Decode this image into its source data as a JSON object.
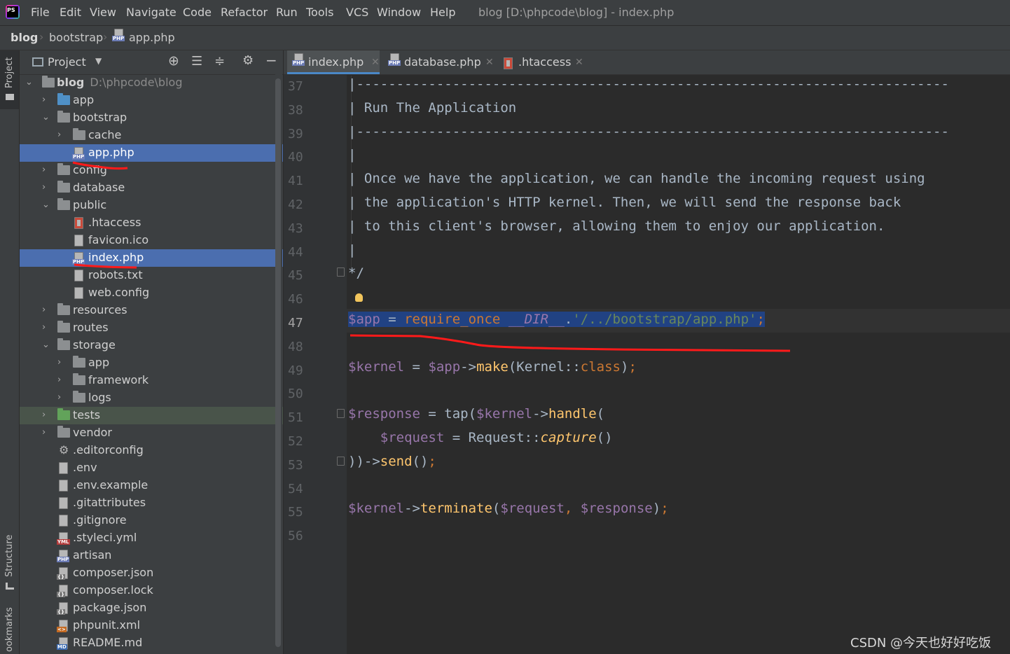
{
  "app": {
    "logo_text": "PS",
    "window_title": "blog [D:\\phpcode\\blog] - index.php",
    "menu": [
      "File",
      "Edit",
      "View",
      "Navigate",
      "Code",
      "Refactor",
      "Run",
      "Tools",
      "VCS",
      "Window",
      "Help"
    ]
  },
  "breadcrumb": [
    "blog",
    "bootstrap",
    "app.php"
  ],
  "toolstrip": {
    "project": "Project",
    "structure": "Structure",
    "bookmarks": "ookmarks"
  },
  "project_panel": {
    "title": "Project",
    "root_label": "blog",
    "root_hint": "D:\\phpcode\\blog",
    "items": [
      {
        "label": "app",
        "type": "folder-blue",
        "depth": 1,
        "expanded": false
      },
      {
        "label": "bootstrap",
        "type": "folder",
        "depth": 1,
        "expanded": true
      },
      {
        "label": "cache",
        "type": "folder",
        "depth": 2,
        "expanded": false
      },
      {
        "label": "app.php",
        "type": "php",
        "depth": 2,
        "selected": true
      },
      {
        "label": "config",
        "type": "folder",
        "depth": 1,
        "expanded": false
      },
      {
        "label": "database",
        "type": "folder",
        "depth": 1,
        "expanded": false
      },
      {
        "label": "public",
        "type": "folder",
        "depth": 1,
        "expanded": true
      },
      {
        "label": ".htaccess",
        "type": "htaccess",
        "depth": 2
      },
      {
        "label": "favicon.ico",
        "type": "file",
        "depth": 2
      },
      {
        "label": "index.php",
        "type": "php",
        "depth": 2,
        "selected": true
      },
      {
        "label": "robots.txt",
        "type": "file",
        "depth": 2
      },
      {
        "label": "web.config",
        "type": "file",
        "depth": 2
      },
      {
        "label": "resources",
        "type": "folder",
        "depth": 1,
        "expanded": false
      },
      {
        "label": "routes",
        "type": "folder",
        "depth": 1,
        "expanded": false
      },
      {
        "label": "storage",
        "type": "folder",
        "depth": 1,
        "expanded": true
      },
      {
        "label": "app",
        "type": "folder",
        "depth": 2,
        "expanded": false
      },
      {
        "label": "framework",
        "type": "folder",
        "depth": 2,
        "expanded": false
      },
      {
        "label": "logs",
        "type": "folder",
        "depth": 2,
        "expanded": false
      },
      {
        "label": "tests",
        "type": "folder-green",
        "depth": 1,
        "expanded": false,
        "highlight": true
      },
      {
        "label": "vendor",
        "type": "folder",
        "depth": 1,
        "expanded": false
      },
      {
        "label": ".editorconfig",
        "type": "gear",
        "depth": 1
      },
      {
        "label": ".env",
        "type": "file",
        "depth": 1
      },
      {
        "label": ".env.example",
        "type": "file",
        "depth": 1
      },
      {
        "label": ".gitattributes",
        "type": "file",
        "depth": 1
      },
      {
        "label": ".gitignore",
        "type": "file",
        "depth": 1
      },
      {
        "label": ".styleci.yml",
        "type": "yml",
        "depth": 1
      },
      {
        "label": "artisan",
        "type": "php",
        "depth": 1
      },
      {
        "label": "composer.json",
        "type": "json",
        "depth": 1
      },
      {
        "label": "composer.lock",
        "type": "json",
        "depth": 1
      },
      {
        "label": "package.json",
        "type": "json",
        "depth": 1
      },
      {
        "label": "phpunit.xml",
        "type": "xml",
        "depth": 1
      },
      {
        "label": "README.md",
        "type": "md",
        "depth": 1
      }
    ]
  },
  "tabs": [
    {
      "label": "index.php",
      "active": true
    },
    {
      "label": "database.php",
      "active": false
    },
    {
      "label": ".htaccess",
      "active": false
    }
  ],
  "editor": {
    "current_line": "47",
    "line_numbers": [
      "37",
      "38",
      "39",
      "40",
      "41",
      "42",
      "43",
      "44",
      "45",
      "46",
      "47",
      "48",
      "49",
      "50",
      "51",
      "52",
      "53",
      "54",
      "55",
      "56"
    ],
    "comment_lines": [
      "|--------------------------------------------------------------------------",
      "| Run The Application",
      "|--------------------------------------------------------------------------",
      "|",
      "| Once we have the application, we can handle the incoming request using",
      "| the application's HTTP kernel. Then, we will send the response back",
      "| to this client's browser, allowing them to enjoy our application.",
      "|",
      "*/"
    ],
    "line47": {
      "var": "$app",
      "op": " = ",
      "kw": "require_once",
      "sp": " ",
      "const": "__DIR__",
      "dot": ".",
      "str": "'/../bootstrap/app.php'",
      "semi": ";"
    },
    "line49": {
      "var": "$kernel",
      "op": " = ",
      "var2": "$app",
      "arrow": "->",
      "fn": "make",
      "rest1": "(Kernel::",
      "kw": "class",
      "rest2": ")",
      "semi": ";"
    },
    "line51": {
      "var": "$response",
      "op": " = tap(",
      "var2": "$kernel",
      "arrow": "->",
      "fn": "handle",
      "rest": "("
    },
    "line52": {
      "indent": "    ",
      "var": "$request",
      "op": " = Request::",
      "fn": "capture",
      "rest": "()"
    },
    "line53": {
      "rest": "))->",
      "fn": "send",
      "rest2": "()",
      "semi": ";"
    },
    "line55": {
      "var": "$kernel",
      "arrow": "->",
      "fn": "terminate",
      "p1": "(",
      "var2": "$request",
      "comma": ", ",
      "var3": "$response",
      "p2": ")",
      "semi": ";"
    }
  },
  "watermark": "CSDN @今天也好好吃饭",
  "colors": {
    "selection": "#4b6eaf",
    "annotation_red": "#ff0000",
    "tab_underline": "#4a88c7"
  }
}
